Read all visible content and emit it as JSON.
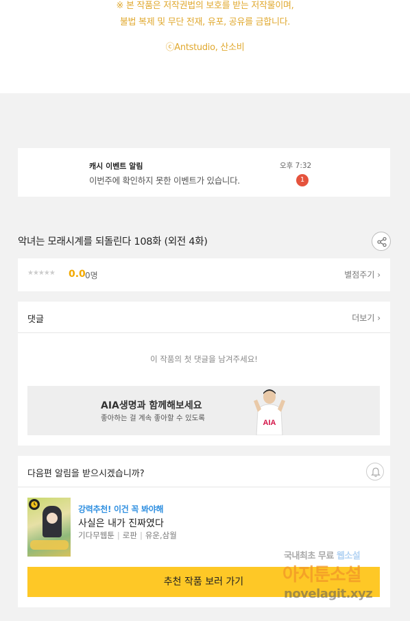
{
  "notice": {
    "line1": "※ 본 작품은 저작권법의 보호를 받는 저작물이며,",
    "line2": "불법 복제 및 무단 전재, 유포, 공유를 금합니다.",
    "copyright": "ⓒAntstudio, 산소비"
  },
  "event": {
    "title": "캐시 이벤트 알림",
    "message": "이번주에 확인하지 못한 이벤트가 있습니다.",
    "time": "오후 7:32",
    "badge": "1"
  },
  "episode": {
    "title": "악녀는 모래시계를 되돌린다 108화 (외전 4화)"
  },
  "rating": {
    "stars": "★★★★★",
    "score": "0.0",
    "count": "0명",
    "rate_label": "별점주기 ›"
  },
  "comments": {
    "label": "댓글",
    "more_label": "더보기 ›",
    "empty_message": "이 작품의 첫 댓글을 남겨주세요!"
  },
  "ad": {
    "title": "AIA생명과 함께해보세요",
    "subtitle": "좋아하는 걸 계속 좋아할 수 있도록",
    "logo": "AIA"
  },
  "next": {
    "question": "다음편 알림을 받으시겠습니까?",
    "rec_tag": "강력추천! 이건 꼭 봐야해",
    "rec_title": "사실은 내가 진짜였다",
    "rec_meta": [
      "기다무웹툰",
      "로판",
      "유운,삼월"
    ],
    "button_label": "추천 작품 보러 가기"
  },
  "watermark": {
    "line1_a": "국내최초 무료",
    "line1_b": "웹소설",
    "line2": "아지툰소설",
    "line3": "novelagit.xyz"
  },
  "colors": {
    "accent_yellow": "#fec826",
    "notice_gold": "#e0a82e",
    "badge_red": "#e5533d",
    "tag_blue": "#2f8fe0",
    "background": "#f2f2f2"
  },
  "icons": [
    "share-icon",
    "bell-icon",
    "clock-icon",
    "chevron-right-icon"
  ]
}
